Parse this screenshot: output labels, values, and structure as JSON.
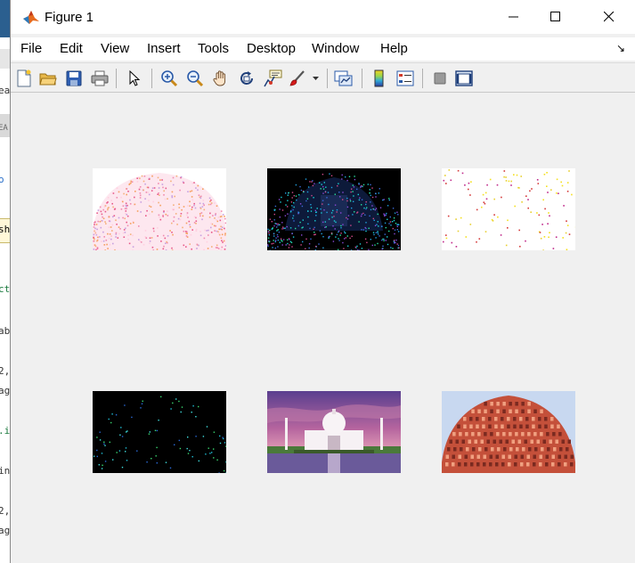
{
  "window": {
    "title": "Figure 1"
  },
  "menu": [
    "File",
    "Edit",
    "View",
    "Insert",
    "Tools",
    "Desktop",
    "Window",
    "Help"
  ],
  "menu_more": "↘",
  "toolbar": [
    "new-figure-icon",
    "open-file-icon",
    "save-icon",
    "print-icon",
    "select-arrow-icon",
    "zoom-in-icon",
    "zoom-out-icon",
    "pan-hand-icon",
    "rotate-3d-icon",
    "data-cursor-icon",
    "brush-icon",
    "link-plot-icon",
    "colorbar-icon",
    "legend-icon",
    "hide-plot-tools-icon",
    "show-plot-tools-icon"
  ],
  "background_editor_fragments": [
    "ea",
    "EA",
    "o",
    "sh",
    "ct",
    "ab",
    "2,",
    "ag",
    ".i",
    "in",
    "2,",
    "ag"
  ],
  "subplots": [
    {
      "name": "hawa-mahal-inverted-edges",
      "row": 1,
      "col": 1
    },
    {
      "name": "taj-mahal-edges-dark",
      "row": 1,
      "col": 2
    },
    {
      "name": "sparse-points-white",
      "row": 1,
      "col": 3
    },
    {
      "name": "sparse-points-black",
      "row": 2,
      "col": 1
    },
    {
      "name": "taj-mahal-photo",
      "row": 2,
      "col": 2
    },
    {
      "name": "hawa-mahal-photo",
      "row": 2,
      "col": 3
    }
  ]
}
